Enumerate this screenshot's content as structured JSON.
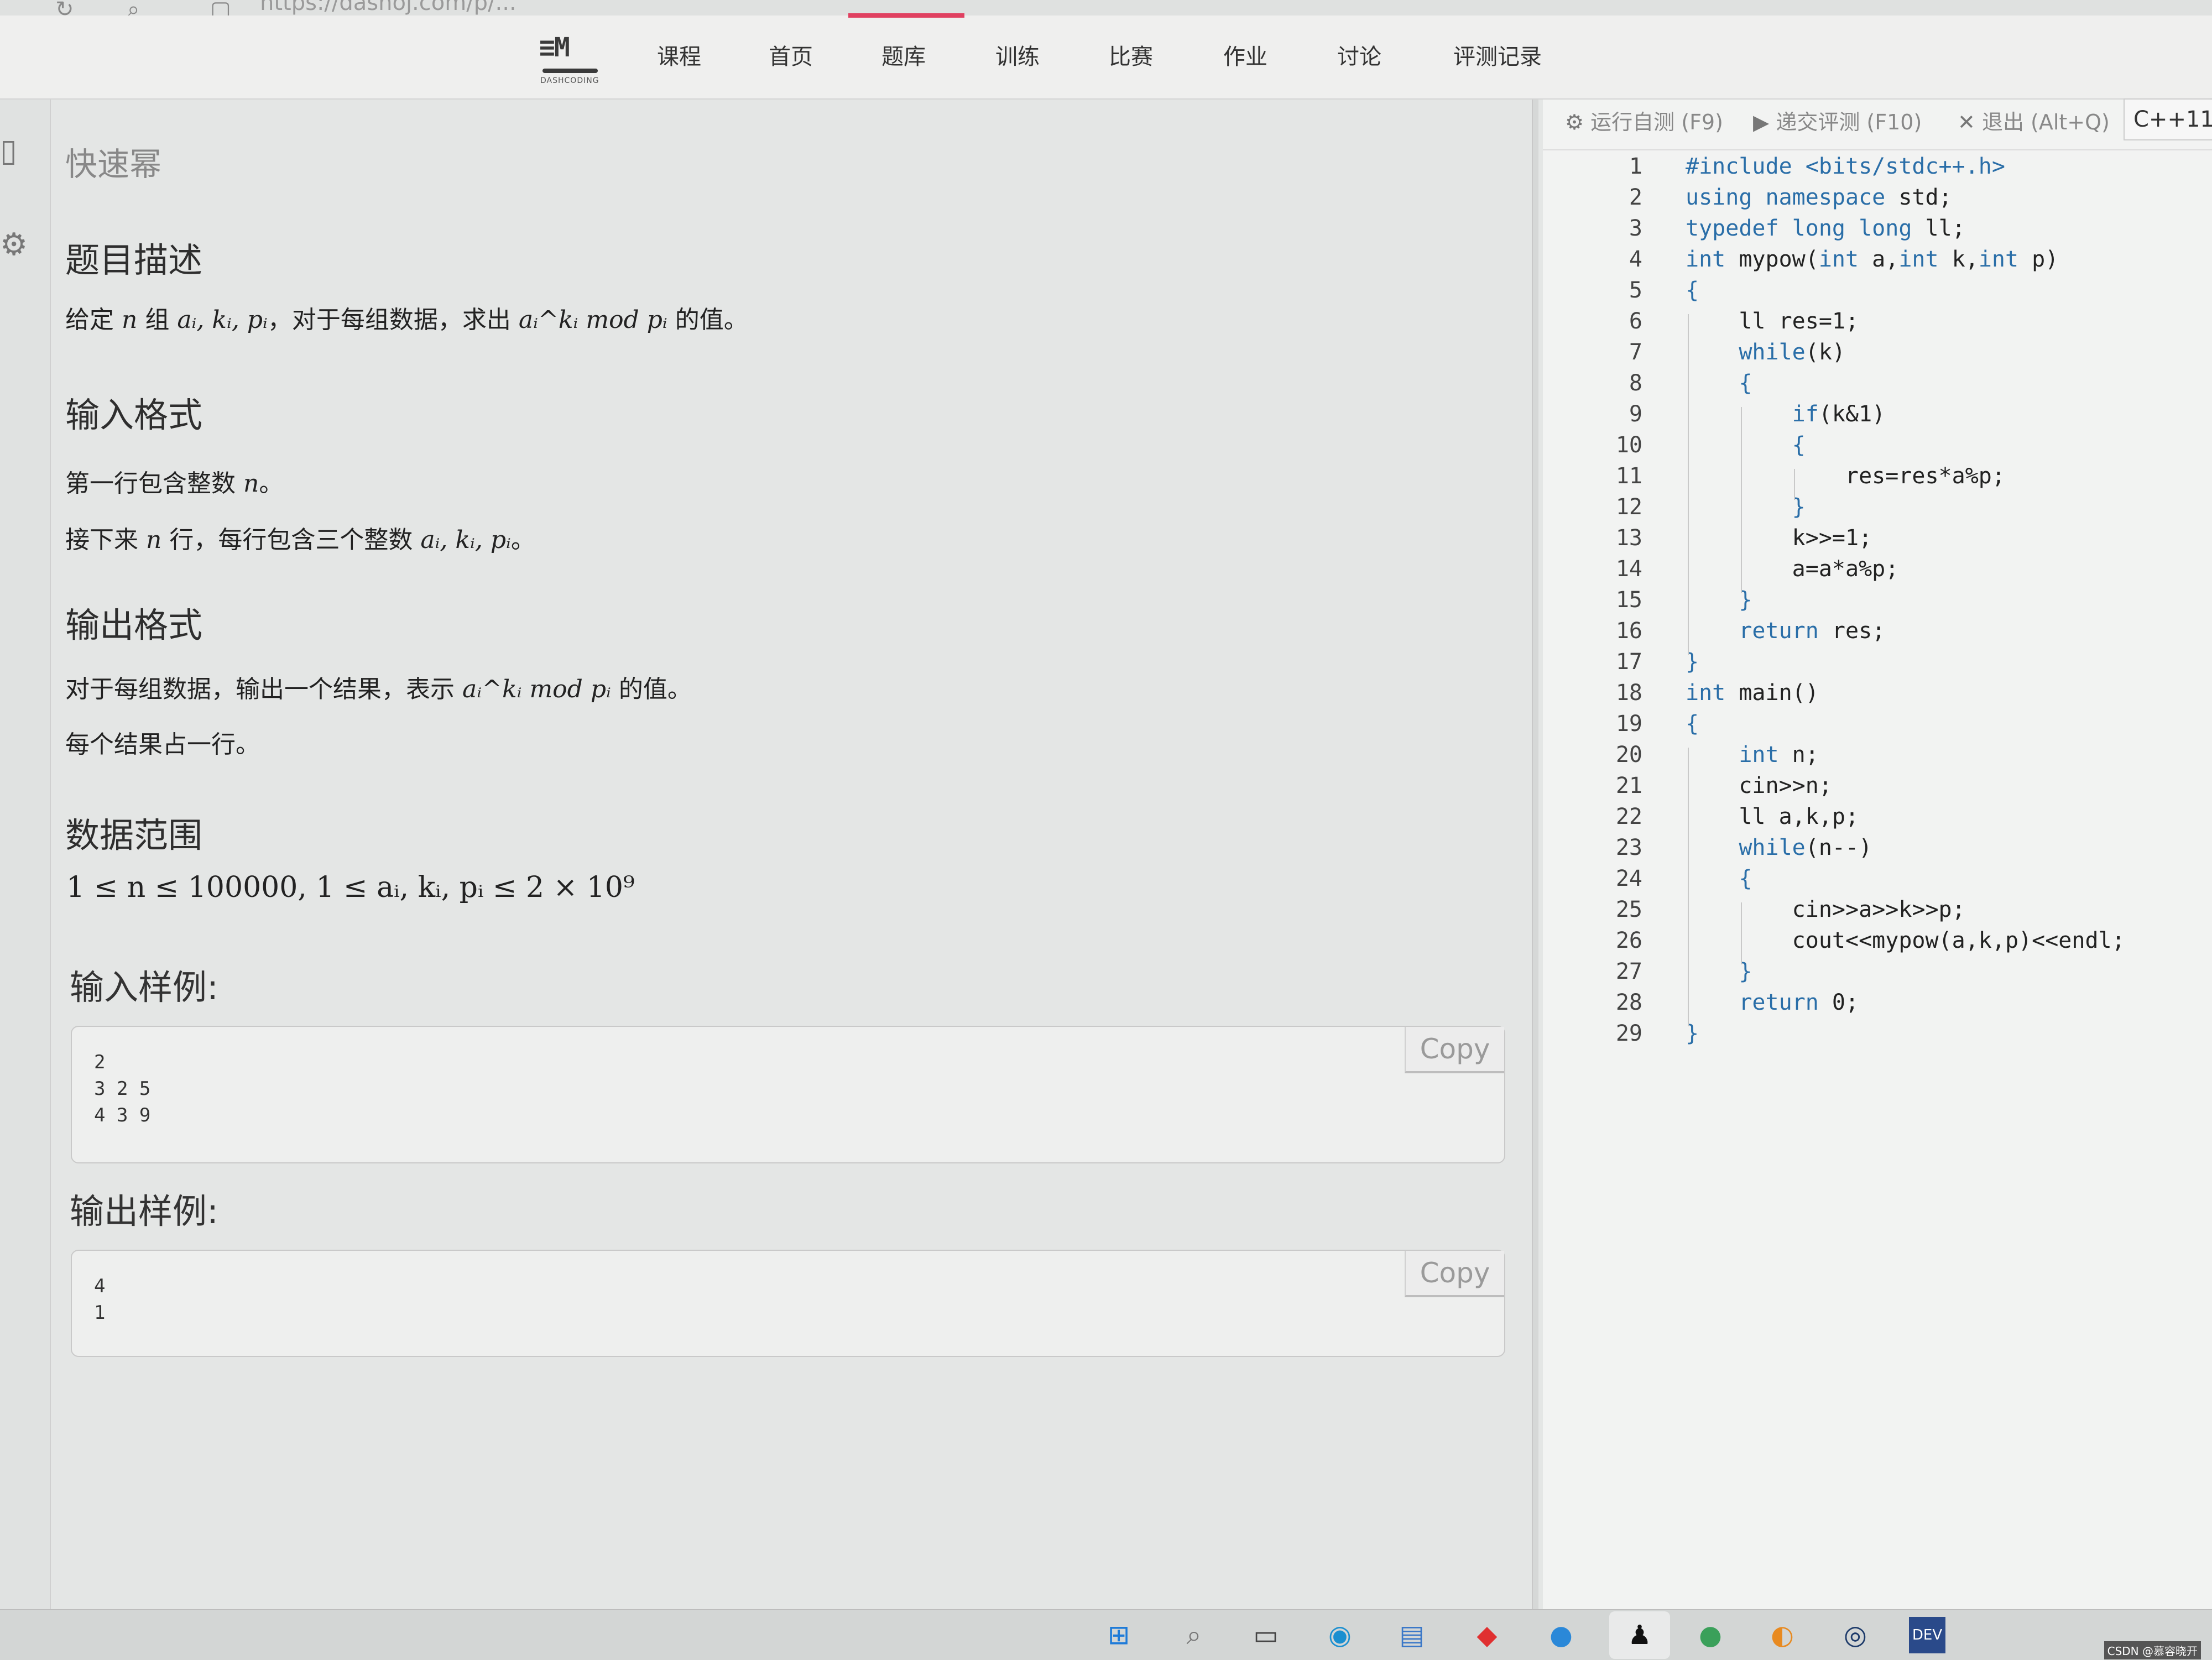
{
  "browser": {
    "url": "https://dasnoj.com/p/..."
  },
  "logo": {
    "mark": "≡M",
    "sub": "DASHCODING"
  },
  "nav": {
    "items": [
      "课程",
      "首页",
      "题库",
      "训练",
      "比赛",
      "作业",
      "讨论",
      "评测记录"
    ],
    "active": "题库"
  },
  "problem": {
    "title": "快速幂",
    "desc_heading": "题目描述",
    "desc_prefix": "给定 ",
    "desc_n": "n",
    "desc_mid": " 组 ",
    "desc_vars": "aᵢ, kᵢ, pᵢ",
    "desc_mid2": "，对于每组数据，求出 ",
    "desc_expr": "aᵢ^kᵢ mod pᵢ",
    "desc_suffix": " 的值。",
    "input_heading": "输入格式",
    "input_line1_prefix": "第一行包含整数 ",
    "input_line1_var": "n",
    "input_line1_suffix": "。",
    "input_line2_prefix": "接下来 ",
    "input_line2_var": "n",
    "input_line2_mid": " 行，每行包含三个整数 ",
    "input_line2_vars": "aᵢ, kᵢ, pᵢ",
    "input_line2_suffix": "。",
    "output_heading": "输出格式",
    "output_line1_prefix": "对于每组数据，输出一个结果，表示 ",
    "output_line1_expr": "aᵢ^kᵢ mod pᵢ",
    "output_line1_suffix": " 的值。",
    "output_line2": "每个结果占一行。",
    "range_heading": "数据范围",
    "range_text": "1 ≤ n ≤ 100000, 1 ≤ aᵢ, kᵢ, pᵢ ≤ 2 × 10⁹",
    "sample_in_label": "输入样例:",
    "sample_in": "2\n3 2 5\n4 3 9",
    "sample_out_label": "输出样例:",
    "sample_out": "4\n1",
    "copy_label": "Copy"
  },
  "editor": {
    "run_label": "运行自测 (F9)",
    "submit_label": "递交评测 (F10)",
    "exit_label": "退出 (Alt+Q)",
    "language": "C++11",
    "code": [
      "#include <bits/stdc++.h>",
      "using namespace std;",
      "typedef long long ll;",
      "int mypow(int a,int k,int p)",
      "{",
      "    ll res=1;",
      "    while(k)",
      "    {",
      "        if(k&1)",
      "        {",
      "            res=res*a%p;",
      "        }",
      "        k>>=1;",
      "        a=a*a%p;",
      "    }",
      "    return res;",
      "}",
      "int main()",
      "{",
      "    int n;",
      "    cin>>n;",
      "    ll a,k,p;",
      "    while(n--)",
      "    {",
      "        cin>>a>>k>>p;",
      "        cout<<mypow(a,k,p)<<endl;",
      "    }",
      "    return 0;",
      "}"
    ]
  },
  "watermark": "CSDN @慕容晓开",
  "icons": {
    "toolbar": [
      "gear-icon",
      "play-circle-icon",
      "close-icon"
    ],
    "taskbar": [
      "windows-start-icon",
      "search-icon",
      "task-view-icon",
      "edge-icon",
      "store-icon",
      "diamond-app-icon",
      "chat-app-icon",
      "qq-icon",
      "wechat-icon",
      "orange-app-icon",
      "steam-icon",
      "devcpp-icon"
    ]
  }
}
